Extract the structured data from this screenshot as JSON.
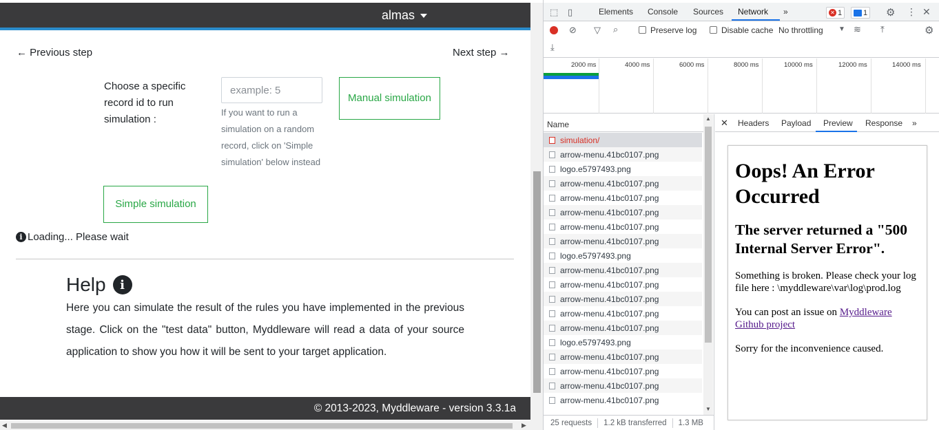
{
  "app": {
    "user_name": "almas",
    "prev_step": "← Previous step",
    "next_step": "Next step →",
    "choose_label": "Choose a specific record id to run simulation :",
    "record_placeholder": "example: 5",
    "hint": "If you want to run a simulation on a random record, click on 'Simple simulation' below instead",
    "manual_button": "Manual simulation",
    "simple_button": "Simple simulation",
    "loading": "Loading... Please wait",
    "help_title": "Help",
    "help_text": "Here you can simulate the result of the rules you have implemented in the previous stage. Click on the \"test data\" button, Myddleware will read a data of your source application to show you how it will be sent to your target application.",
    "footer": "© 2013-2023, Myddleware - version 3.3.1a"
  },
  "devtools": {
    "tabs": [
      "Elements",
      "Console",
      "Sources",
      "Network"
    ],
    "more_tabs": "»",
    "active_tab": "Network",
    "error_count": "1",
    "message_count": "1",
    "toolbar": {
      "preserve_log": "Preserve log",
      "disable_cache": "Disable cache",
      "throttling": "No throttling"
    },
    "timeline_ticks": [
      "2000 ms",
      "4000 ms",
      "6000 ms",
      "8000 ms",
      "10000 ms",
      "12000 ms",
      "14000 ms"
    ],
    "requests_header": "Name",
    "requests": [
      "simulation/",
      "arrow-menu.41bc0107.png",
      "logo.e5797493.png",
      "arrow-menu.41bc0107.png",
      "arrow-menu.41bc0107.png",
      "arrow-menu.41bc0107.png",
      "arrow-menu.41bc0107.png",
      "arrow-menu.41bc0107.png",
      "logo.e5797493.png",
      "arrow-menu.41bc0107.png",
      "arrow-menu.41bc0107.png",
      "arrow-menu.41bc0107.png",
      "arrow-menu.41bc0107.png",
      "arrow-menu.41bc0107.png",
      "logo.e5797493.png",
      "arrow-menu.41bc0107.png",
      "arrow-menu.41bc0107.png",
      "arrow-menu.41bc0107.png",
      "arrow-menu.41bc0107.png"
    ],
    "status": {
      "requests": "25 requests",
      "transferred": "1.2 kB transferred",
      "resources": "1.3 MB"
    },
    "detail_tabs": [
      "Headers",
      "Payload",
      "Preview",
      "Response"
    ],
    "active_detail_tab": "Preview",
    "preview": {
      "h1": "Oops! An Error Occurred",
      "h2": "The server returned a \"500 Internal Server Error\".",
      "p1": "Something is broken. Please check your log file here : \\myddleware\\var\\log\\prod.log",
      "p2_prefix": "You can post an issue on ",
      "p2_link": "Myddleware Github project",
      "p3": "Sorry for the inconvenience caused."
    }
  }
}
